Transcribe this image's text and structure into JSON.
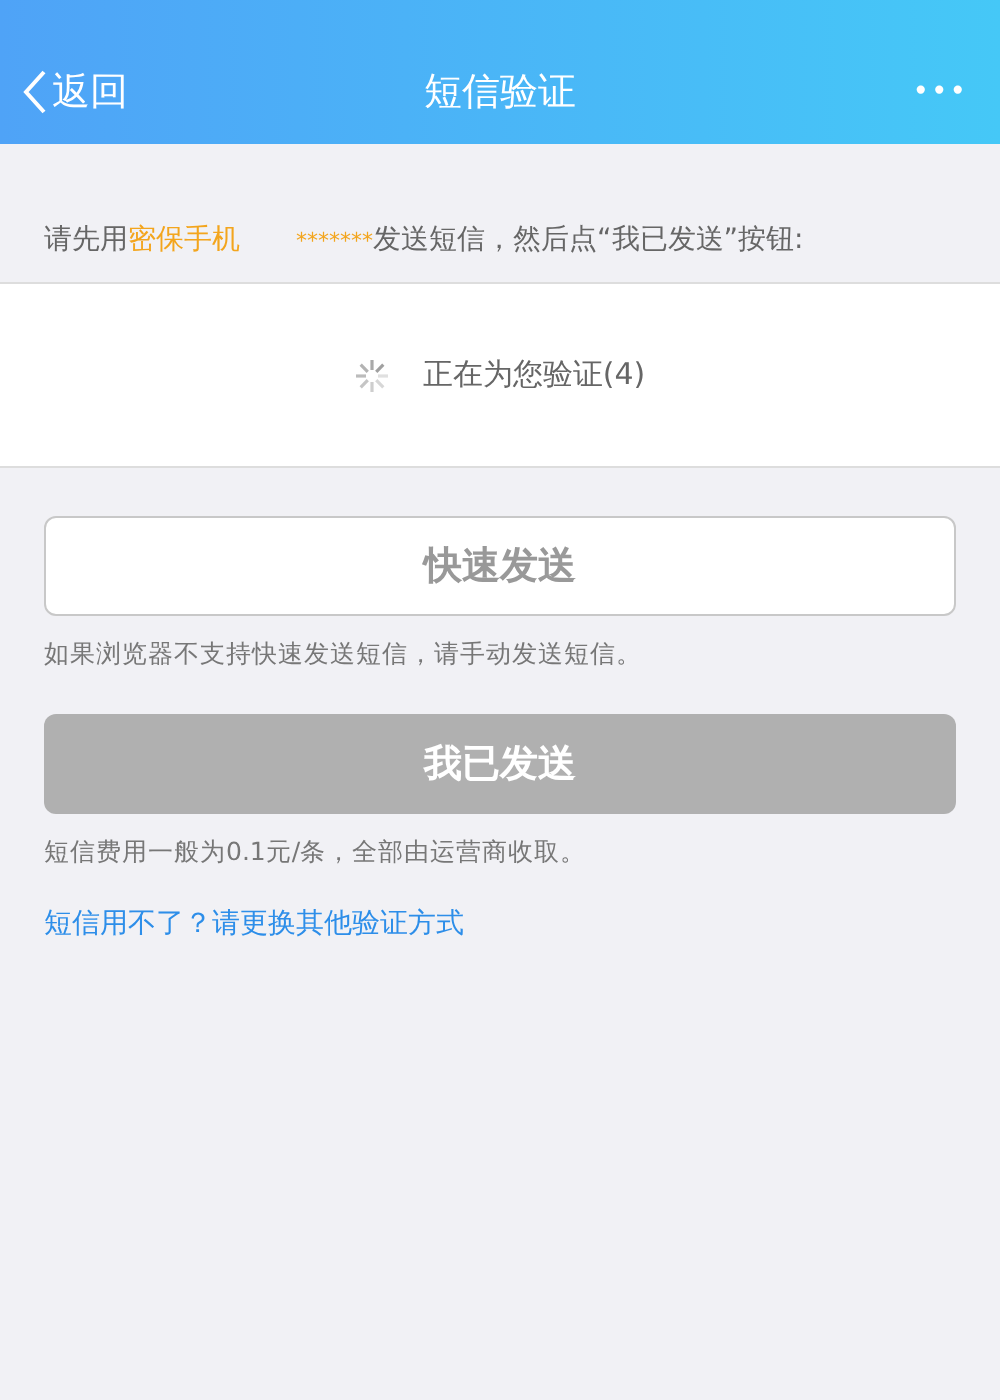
{
  "nav": {
    "back": "返回",
    "title": "短信验证",
    "more": "•••"
  },
  "instruction": [
    {
      "kind": "plain",
      "text": "请先用"
    },
    {
      "kind": "highlight",
      "text": "密保手机"
    },
    {
      "kind": "highlight",
      "text": "*******"
    },
    {
      "kind": "plain",
      "text": "发送短信，然后点“我已发送”按钮:"
    }
  ],
  "status": {
    "text": "正在为您验证(4)"
  },
  "quick_send": {
    "label": "快速发送",
    "disabled": false
  },
  "quick_note": "如果浏览器不支持快速发送短信，请手动发送短信。",
  "sent_button": {
    "label": "我已发送",
    "disabled": true
  },
  "fee_note": "短信费用一般为0.1元/条，全部由运营商收取。",
  "alt_link": "短信用不了？请更换其他验证方式"
}
